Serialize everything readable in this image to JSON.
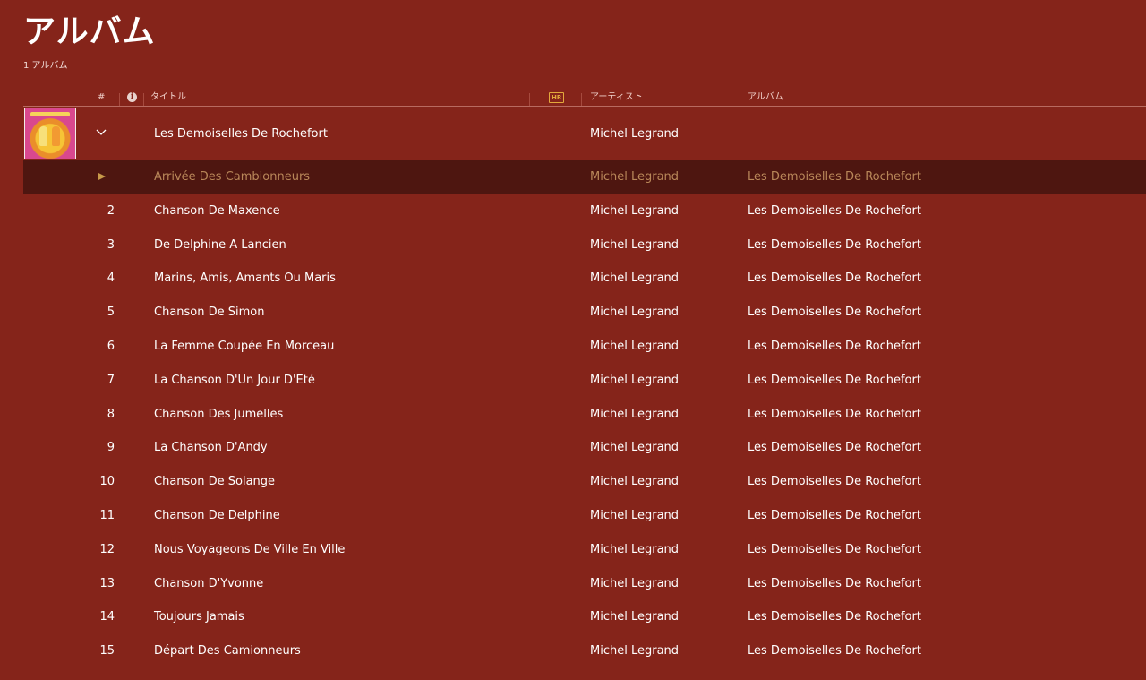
{
  "page": {
    "title": "アルバム",
    "album_count": "1 アルバム"
  },
  "columns": {
    "number": "#",
    "title": "タイトル",
    "hr": "HR",
    "artist": "アーティスト",
    "album": "アルバム"
  },
  "album_group": {
    "title": "Les Demoiselles De Rochefort",
    "artist": "Michel Legrand",
    "expand_icon": "chevron-down-icon"
  },
  "colors": {
    "background": "#85241a",
    "playing_row": "#4e1610",
    "playing_text": "#b98759",
    "hr_badge": "#e2a83c"
  },
  "tracks": [
    {
      "number": "",
      "title": "Arrivée Des Cambionneurs",
      "artist": "Michel Legrand",
      "album": "Les Demoiselles De Rochefort",
      "playing": true
    },
    {
      "number": "2",
      "title": "Chanson De Maxence",
      "artist": "Michel Legrand",
      "album": "Les Demoiselles De Rochefort"
    },
    {
      "number": "3",
      "title": "De Delphine A Lancien",
      "artist": "Michel Legrand",
      "album": "Les Demoiselles De Rochefort"
    },
    {
      "number": "4",
      "title": "Marins, Amis, Amants Ou Maris",
      "artist": "Michel Legrand",
      "album": "Les Demoiselles De Rochefort"
    },
    {
      "number": "5",
      "title": "Chanson De Simon",
      "artist": "Michel Legrand",
      "album": "Les Demoiselles De Rochefort"
    },
    {
      "number": "6",
      "title": "La Femme Coupée En Morceau",
      "artist": "Michel Legrand",
      "album": "Les Demoiselles De Rochefort"
    },
    {
      "number": "7",
      "title": "La Chanson D'Un Jour D'Eté",
      "artist": "Michel Legrand",
      "album": "Les Demoiselles De Rochefort"
    },
    {
      "number": "8",
      "title": "Chanson Des Jumelles",
      "artist": "Michel Legrand",
      "album": "Les Demoiselles De Rochefort"
    },
    {
      "number": "9",
      "title": "La Chanson D'Andy",
      "artist": "Michel Legrand",
      "album": "Les Demoiselles De Rochefort"
    },
    {
      "number": "10",
      "title": "Chanson De Solange",
      "artist": "Michel Legrand",
      "album": "Les Demoiselles De Rochefort"
    },
    {
      "number": "11",
      "title": "Chanson De Delphine",
      "artist": "Michel Legrand",
      "album": "Les Demoiselles De Rochefort"
    },
    {
      "number": "12",
      "title": "Nous Voyageons De Ville En Ville",
      "artist": "Michel Legrand",
      "album": "Les Demoiselles De Rochefort"
    },
    {
      "number": "13",
      "title": "Chanson D'Yvonne",
      "artist": "Michel Legrand",
      "album": "Les Demoiselles De Rochefort"
    },
    {
      "number": "14",
      "title": "Toujours Jamais",
      "artist": "Michel Legrand",
      "album": "Les Demoiselles De Rochefort"
    },
    {
      "number": "15",
      "title": "Départ Des Camionneurs",
      "artist": "Michel Legrand",
      "album": "Les Demoiselles De Rochefort"
    }
  ]
}
